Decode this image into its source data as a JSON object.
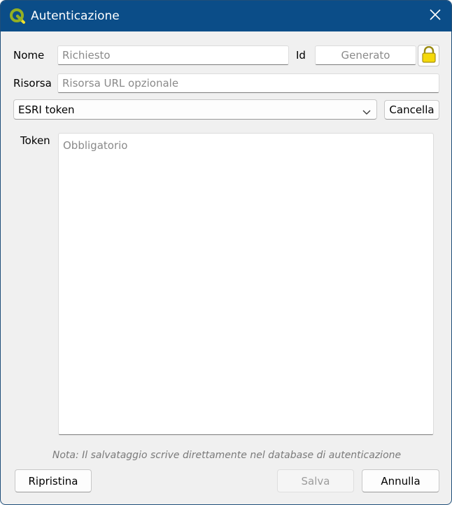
{
  "window": {
    "title": "Autenticazione",
    "titlebar_color": "#0b4d88"
  },
  "form": {
    "name_label": "Nome",
    "name_placeholder": "Richiesto",
    "id_label": "Id",
    "id_placeholder": "Generato",
    "resource_label": "Risorsa",
    "resource_placeholder": "Risorsa URL opzionale",
    "method_selected": "ESRI token",
    "clear_button": "Cancella",
    "token_label": "Token",
    "token_placeholder": "Obbligatorio"
  },
  "note": "Nota: Il salvataggio scrive direttamente nel database di autenticazione",
  "footer": {
    "reset_button": "Ripristina",
    "save_button": "Salva",
    "cancel_button": "Annulla"
  },
  "icons": {
    "app": "qgis-logo-icon",
    "close": "close-icon",
    "lock": "lock-icon",
    "dropdown": "chevron-down-icon"
  }
}
